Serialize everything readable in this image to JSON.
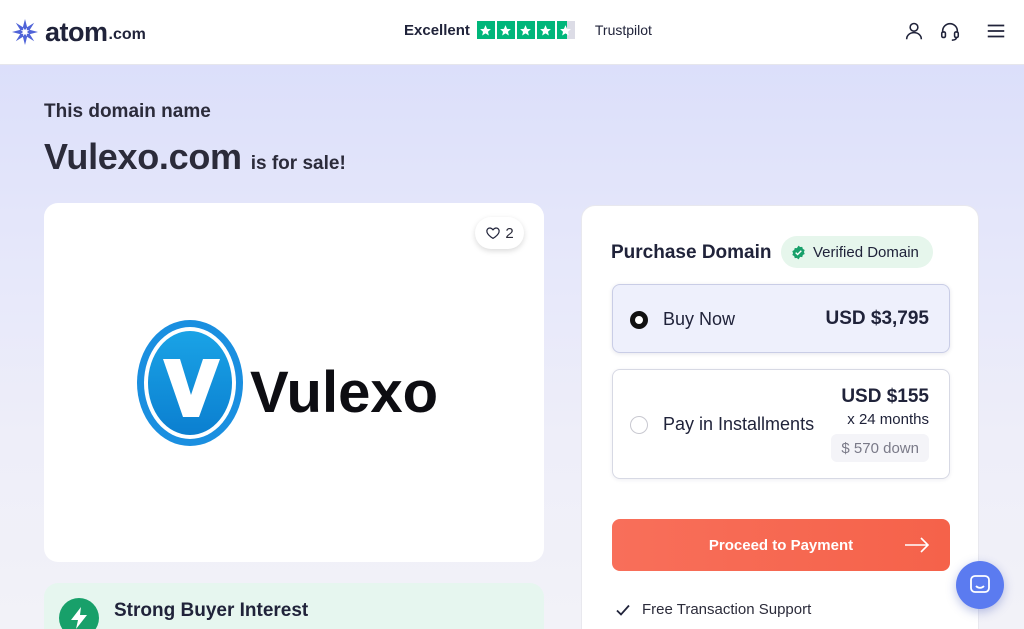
{
  "header": {
    "logo_text": "atom",
    "logo_suffix": ".com",
    "trust_label": "Excellent",
    "trust_brand": "Trustpilot",
    "trust_star_color": "#00b67a",
    "icons": [
      "user-icon",
      "headset-icon",
      "menu-icon"
    ]
  },
  "hero": {
    "kicker": "This domain name",
    "domain": "Vulexo.com",
    "suffix": "is for sale!"
  },
  "logo_card": {
    "likes": "2",
    "brand_name": "Vulexo"
  },
  "interest": {
    "label": "Strong Buyer Interest"
  },
  "purchase": {
    "title": "Purchase Domain",
    "verified_label": "Verified Domain",
    "buy_now": {
      "label": "Buy Now",
      "price": "USD $3,795",
      "selected": true
    },
    "installments": {
      "label": "Pay in Installments",
      "price": "USD $155",
      "term": "x 24 months",
      "down": "$ 570 down",
      "selected": false
    },
    "cta_label": "Proceed to Payment",
    "cta_color": "#f5624a",
    "features": [
      "Free Transaction Support"
    ]
  },
  "colors": {
    "accent": "#5b7bf0",
    "verified_green": "#18a06a"
  }
}
